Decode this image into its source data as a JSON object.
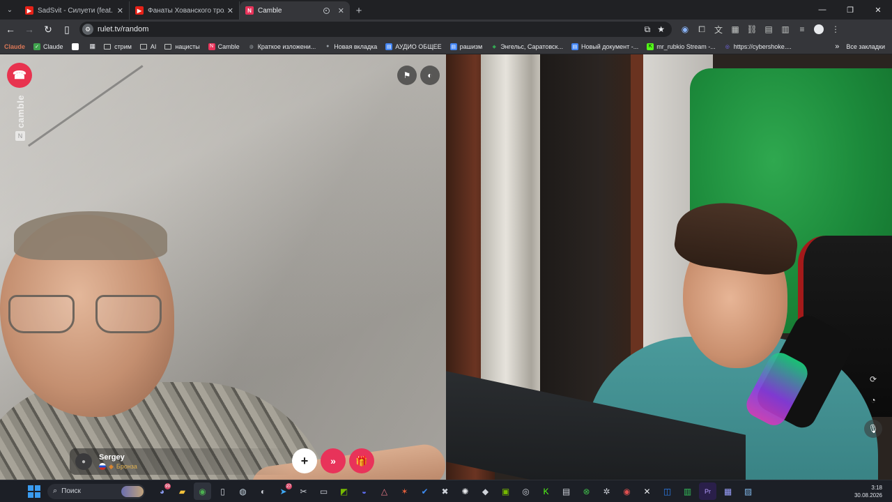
{
  "browser": {
    "tabs": [
      {
        "title": "SadSvit - Силуети (feat. СТРУКТУРА)",
        "favicon": "youtube-icon",
        "color": "#e62117",
        "active": false
      },
      {
        "title": "Фанаты Хованского тролят Ла...",
        "favicon": "youtube-icon",
        "color": "#e62117",
        "active": false
      },
      {
        "title": "Camble",
        "favicon": "camble-icon",
        "color": "#e8335a",
        "active": true
      }
    ],
    "new_tab": "+",
    "window_controls": {
      "minimize": "—",
      "restore": "❐",
      "close": "✕"
    },
    "url": "rulet.tv/random",
    "bookmarks": [
      {
        "label": "Claude",
        "icon": "claude-icon",
        "color": "#d97757"
      },
      {
        "label": "Claude",
        "icon": "claude-check-icon",
        "color": "#3fa34d"
      },
      {
        "label": "",
        "icon": "page-icon",
        "color": "#ffffff"
      },
      {
        "label": "",
        "icon": "apps-grid-icon",
        "color": "#c4c7c5"
      },
      {
        "label": "стрим",
        "icon": "folder-icon",
        "color": ""
      },
      {
        "label": "AI",
        "icon": "folder-icon",
        "color": ""
      },
      {
        "label": "нацисты",
        "icon": "folder-icon",
        "color": ""
      },
      {
        "label": "Camble",
        "icon": "camble-icon",
        "color": "#e8335a"
      },
      {
        "label": "Краткое изложени...",
        "icon": "globe-icon",
        "color": "#9aa0a6"
      },
      {
        "label": "Новая вкладка",
        "icon": "person-icon",
        "color": "#9aa0a6"
      },
      {
        "label": "АУДИО ОБЩЕЕ",
        "icon": "doc-icon",
        "color": "#4285f4"
      },
      {
        "label": "рашизм",
        "icon": "doc-icon",
        "color": "#4285f4"
      },
      {
        "label": "Энгельс, Саратовск...",
        "icon": "maps-pin-icon",
        "color": "#34a853"
      },
      {
        "label": "Новый документ -...",
        "icon": "doc-icon",
        "color": "#4285f4"
      },
      {
        "label": "mr_rubkio Stream -...",
        "icon": "kick-icon",
        "color": "#53fc18"
      },
      {
        "label": "https://cybershoke....",
        "icon": "cybershoke-icon",
        "color": "#7b6cff"
      }
    ],
    "bookmarks_more": "»",
    "all_bookmarks": "Все закладки"
  },
  "call": {
    "partner_name": "Sergey",
    "partner_rank": "Бронза",
    "brand": "camble",
    "accent": "#e8335a"
  },
  "taskbar": {
    "search_placeholder": "Поиск",
    "time": "3:18",
    "date": "30.08.2026",
    "apps": [
      {
        "icon": "discord-icon",
        "badge": "99"
      },
      {
        "icon": "file-explorer-icon",
        "badge": ""
      },
      {
        "icon": "chrome-icon",
        "badge": "",
        "active": true
      },
      {
        "icon": "notepad-icon",
        "badge": ""
      },
      {
        "icon": "steam-icon",
        "badge": ""
      },
      {
        "icon": "app-icon",
        "badge": ""
      },
      {
        "icon": "telegram-icon",
        "badge": "27"
      },
      {
        "icon": "snipping-tool-icon",
        "badge": ""
      },
      {
        "icon": "terminal-icon",
        "badge": ""
      },
      {
        "icon": "nvidia-icon",
        "badge": ""
      },
      {
        "icon": "arc-icon",
        "badge": ""
      },
      {
        "icon": "affinity-icon",
        "badge": ""
      },
      {
        "icon": "star-icon",
        "badge": ""
      },
      {
        "icon": "vpn-icon",
        "badge": ""
      },
      {
        "icon": "capcut-icon",
        "badge": ""
      },
      {
        "icon": "chatgpt-icon",
        "badge": ""
      },
      {
        "icon": "cursor-icon",
        "badge": ""
      },
      {
        "icon": "nvidia-broadcast-icon",
        "badge": ""
      },
      {
        "icon": "obs-icon",
        "badge": ""
      },
      {
        "icon": "kick-icon",
        "badge": ""
      },
      {
        "icon": "file-icon",
        "badge": ""
      },
      {
        "icon": "xbox-icon",
        "badge": ""
      },
      {
        "icon": "settings-icon",
        "badge": ""
      },
      {
        "icon": "obs-studio-icon",
        "badge": ""
      },
      {
        "icon": "x-icon",
        "badge": ""
      },
      {
        "icon": "controller-icon",
        "badge": ""
      },
      {
        "icon": "chart-icon",
        "badge": ""
      },
      {
        "icon": "premiere-icon",
        "badge": ""
      },
      {
        "icon": "teams-icon",
        "badge": ""
      },
      {
        "icon": "image-icon",
        "badge": ""
      }
    ]
  }
}
